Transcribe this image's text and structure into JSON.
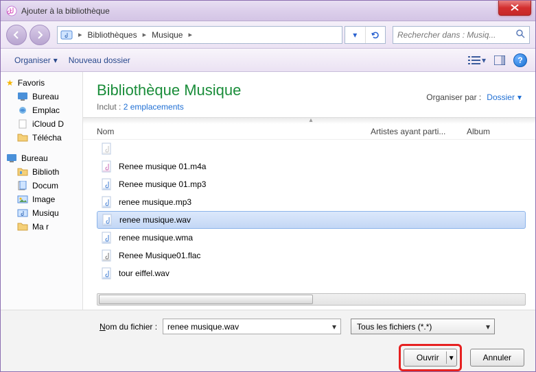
{
  "window": {
    "title": "Ajouter à la bibliothèque"
  },
  "nav": {
    "breadcrumb": [
      "Bibliothèques",
      "Musique"
    ],
    "search_placeholder": "Rechercher dans : Musiq..."
  },
  "toolbar": {
    "organize": "Organiser",
    "new_folder": "Nouveau dossier"
  },
  "sidebar": {
    "favorites": {
      "label": "Favoris",
      "items": [
        "Bureau",
        "Emplac",
        "iCloud D",
        "Télécha"
      ]
    },
    "desktop": {
      "label": "Bureau",
      "items": [
        "Biblioth",
        "Docum",
        "Image",
        "Musiqu",
        "Ma r"
      ]
    }
  },
  "main": {
    "title": "Bibliothèque Musique",
    "subtitle_prefix": "Inclut : ",
    "subtitle_link": "2 emplacements",
    "organize_label": "Organiser par :",
    "organize_value": "Dossier",
    "columns": {
      "name": "Nom",
      "artists": "Artistes ayant parti...",
      "album": "Album"
    },
    "files": [
      {
        "name": "",
        "icon": "doc",
        "dim": true
      },
      {
        "name": "Renee musique 01.m4a",
        "icon": "m4a"
      },
      {
        "name": "Renee musique 01.mp3",
        "icon": "mp3"
      },
      {
        "name": "renee musique.mp3",
        "icon": "mp3"
      },
      {
        "name": "renee musique.wav",
        "icon": "wav",
        "selected": true
      },
      {
        "name": "renee musique.wma",
        "icon": "wma"
      },
      {
        "name": "Renee Musique01.flac",
        "icon": "flac"
      },
      {
        "name": "tour eiffel.wav",
        "icon": "wav"
      }
    ]
  },
  "footer": {
    "filename_label": "Nom du fichier :",
    "filename_value": "renee musique.wav",
    "filter": "Tous les fichiers (*.*)",
    "open": "Ouvrir",
    "cancel": "Annuler"
  }
}
